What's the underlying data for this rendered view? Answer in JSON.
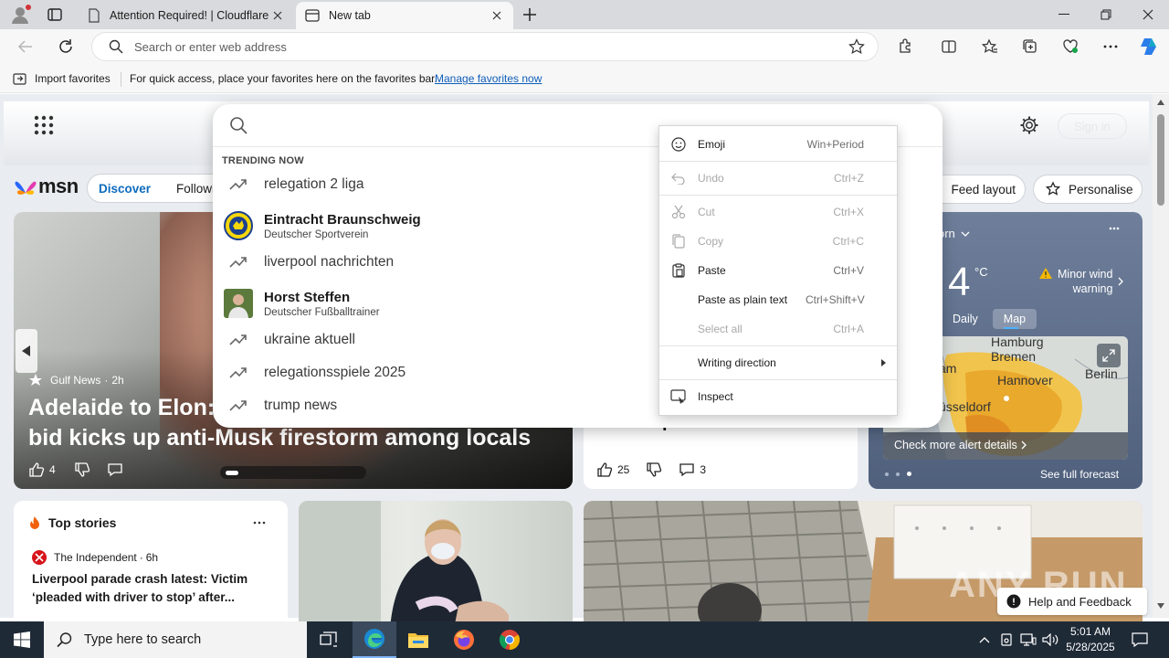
{
  "browser": {
    "tabs": [
      {
        "title": "Attention Required! | Cloudflare"
      },
      {
        "title": "New tab"
      }
    ],
    "address_placeholder": "Search or enter web address",
    "favorites_bar": {
      "import_label": "Import favorites",
      "message": "For quick access, place your favorites here on the favorites bar.",
      "link": "Manage favorites now"
    }
  },
  "msn": {
    "logo_text": "msn",
    "nav": [
      "Discover",
      "Followin"
    ],
    "sign_in": "Sign in",
    "feed_layout": "Feed layout",
    "personalise": "Personalise",
    "hero": {
      "source": "Gulf News",
      "age": "2h",
      "headline_line1": "Adelaide to Elon: 'I",
      "headline_line2": "bid kicks up anti-Musk firestorm among locals",
      "likes": "4"
    },
    "mid_card": {
      "headline_fragment": "p",
      "likes": "25",
      "comments": "3"
    },
    "weather": {
      "location": "orn",
      "temp": "4",
      "unit": "°C",
      "alert_line1": "Minor wind",
      "alert_line2": "warning",
      "tabs": [
        "Daily",
        "Map"
      ],
      "selected_tab": "Map",
      "cities": [
        "Hamburg",
        "Bremen",
        "Hannover",
        "Berlin",
        "am",
        "üsseldorf"
      ],
      "check_alert": "Check more alert details",
      "full_forecast": "See full forecast"
    },
    "top_stories": {
      "title": "Top stories",
      "source": "The Independent",
      "age": "6h",
      "headline": "Liverpool parade crash latest: Victim ‘pleaded with driver to stop’ after..."
    },
    "help": "Help and Feedback",
    "watermark": "ANY RUN"
  },
  "search_panel": {
    "trending_label": "TRENDING NOW",
    "suggestions": [
      {
        "type": "trend",
        "text": "relegation 2 liga"
      },
      {
        "type": "entity",
        "text": "Eintracht Braunschweig",
        "sub": "Deutscher Sportverein"
      },
      {
        "type": "trend",
        "text": "liverpool nachrichten"
      },
      {
        "type": "entity",
        "text": "Horst Steffen",
        "sub": "Deutscher Fußballtrainer"
      },
      {
        "type": "trend",
        "text": "ukraine aktuell"
      },
      {
        "type": "trend",
        "text": "relegationsspiele 2025"
      },
      {
        "type": "trend",
        "text": "trump news"
      }
    ]
  },
  "context_menu": {
    "items": [
      {
        "label": "Emoji",
        "shortcut": "Win+Period",
        "enabled": true,
        "icon": "emoji-icon"
      },
      {
        "label": "Undo",
        "shortcut": "Ctrl+Z",
        "enabled": false,
        "icon": "undo-icon"
      },
      {
        "label": "Cut",
        "shortcut": "Ctrl+X",
        "enabled": false,
        "icon": "cut-icon"
      },
      {
        "label": "Copy",
        "shortcut": "Ctrl+C",
        "enabled": false,
        "icon": "copy-icon"
      },
      {
        "label": "Paste",
        "shortcut": "Ctrl+V",
        "enabled": true,
        "icon": "paste-icon"
      },
      {
        "label": "Paste as plain text",
        "shortcut": "Ctrl+Shift+V",
        "enabled": true,
        "icon": ""
      },
      {
        "label": "Select all",
        "shortcut": "Ctrl+A",
        "enabled": false,
        "icon": ""
      },
      {
        "label": "Writing direction",
        "shortcut": "",
        "enabled": true,
        "icon": "",
        "submenu": true
      },
      {
        "label": "Inspect",
        "shortcut": "",
        "enabled": true,
        "icon": "inspect-icon"
      }
    ]
  },
  "taskbar": {
    "search_placeholder": "Type here to search",
    "time": "5:01 AM",
    "date": "5/28/2025"
  },
  "colors": {
    "accent": "#0f6cbd",
    "taskbar": "#1f2a37",
    "weather_bg": "#5e7190"
  }
}
